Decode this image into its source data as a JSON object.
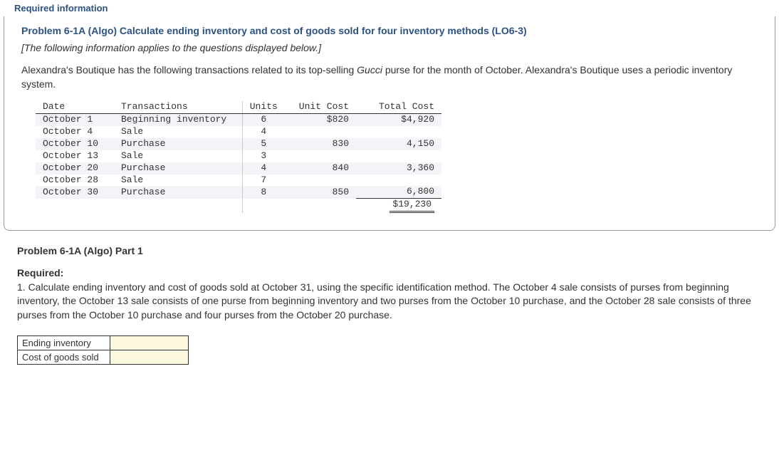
{
  "header_tab": "Required information",
  "problem": {
    "title": "Problem 6-1A (Algo) Calculate ending inventory and cost of goods sold for four inventory methods (LO6-3)",
    "applies_note": "[The following information applies to the questions displayed below.]",
    "narrative_pre": "Alexandra's Boutique has the following transactions related to its top-selling ",
    "narrative_italic": "Gucci",
    "narrative_post": " purse for the month of October. Alexandra's Boutique uses a periodic inventory system."
  },
  "table_headers": {
    "date": "Date",
    "trans": "Transactions",
    "units": "Units",
    "unit_cost": "Unit Cost",
    "total_cost": "Total Cost"
  },
  "rows": [
    {
      "date": "October 1",
      "trans": "Beginning inventory",
      "units": "6",
      "unit_cost": "$820",
      "total": "$4,920"
    },
    {
      "date": "October 4",
      "trans": "Sale",
      "units": "4",
      "unit_cost": "",
      "total": ""
    },
    {
      "date": "October 10",
      "trans": "Purchase",
      "units": "5",
      "unit_cost": "830",
      "total": "4,150"
    },
    {
      "date": "October 13",
      "trans": "Sale",
      "units": "3",
      "unit_cost": "",
      "total": ""
    },
    {
      "date": "October 20",
      "trans": "Purchase",
      "units": "4",
      "unit_cost": "840",
      "total": "3,360"
    },
    {
      "date": "October 28",
      "trans": "Sale",
      "units": "7",
      "unit_cost": "",
      "total": ""
    },
    {
      "date": "October 30",
      "trans": "Purchase",
      "units": "8",
      "unit_cost": "850",
      "total": "6,800"
    }
  ],
  "grand_total": "$19,230",
  "part1_heading": "Problem 6-1A (Algo) Part 1",
  "required_label": "Required:",
  "required_text": "1. Calculate ending inventory and cost of goods sold at October 31, using the specific identification method. The October 4 sale consists of purses from beginning inventory, the October 13 sale consists of one purse from beginning inventory and two purses from the October 10 purchase, and the October 28 sale consists of three purses from the October 10 purchase and four purses from the October 20 purchase.",
  "answers": {
    "ending_inv_label": "Ending inventory",
    "cogs_label": "Cost of goods sold"
  }
}
